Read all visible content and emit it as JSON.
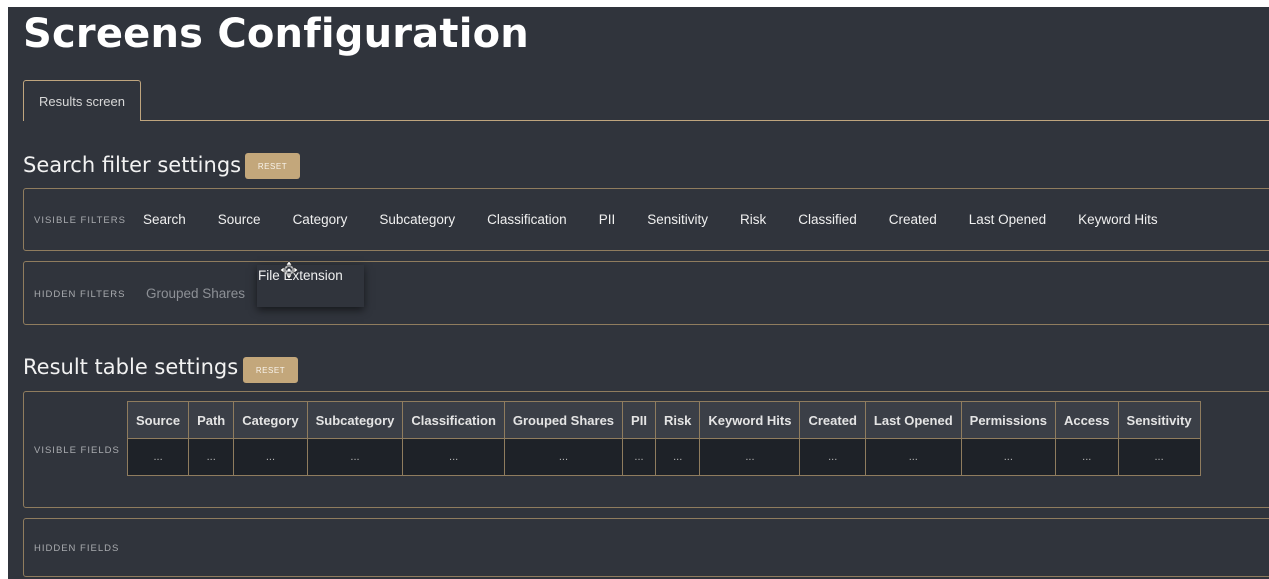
{
  "page": {
    "title": "Screens Configuration"
  },
  "tabs": [
    {
      "label": "Results screen"
    }
  ],
  "search_filter": {
    "title": "Search filter settings",
    "reset_label": "RESET",
    "visible_label": "VISIBLE FILTERS",
    "visible_filters": [
      "Search",
      "Source",
      "Category",
      "Subcategory",
      "Classification",
      "PII",
      "Sensitivity",
      "Risk",
      "Classified",
      "Created",
      "Last Opened",
      "Keyword Hits"
    ],
    "hidden_label": "HIDDEN FILTERS",
    "hidden_filters": [
      "Grouped Shares"
    ],
    "dragging_filter": "File Extension"
  },
  "result_table": {
    "title": "Result table settings",
    "reset_label": "RESET",
    "visible_label": "VISIBLE FIELDS",
    "columns": [
      "Source",
      "Path",
      "Category",
      "Subcategory",
      "Classification",
      "Grouped Shares",
      "PII",
      "Risk",
      "Keyword Hits",
      "Created",
      "Last Opened",
      "Permissions",
      "Access",
      "Sensitivity"
    ],
    "cell_placeholder": "...",
    "hidden_label": "HIDDEN FIELDS"
  },
  "colors": {
    "background": "#30343c",
    "accent": "#c3a77b",
    "border": "#8f7c5e"
  },
  "icons": {
    "drag_cursor": "move-cursor-icon"
  }
}
